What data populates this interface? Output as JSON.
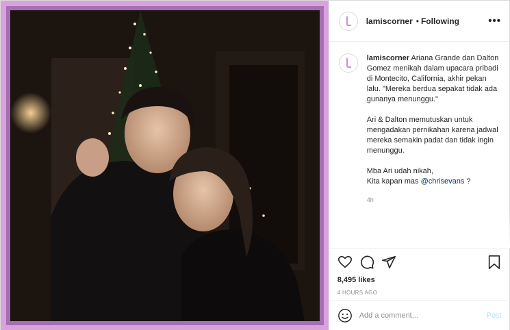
{
  "header": {
    "username": "lamiscorner",
    "separator": "•",
    "follow_status": "Following",
    "more_label": "•••"
  },
  "caption": {
    "username": "lamiscorner",
    "paragraph_1": "Ariana Grande dan Dalton Gomez menikah dalam upacara pribadi di Montecito, California, akhir pekan lalu. \"Mereka berdua sepakat tidak ada gunanya menunggu.\"",
    "paragraph_2": "Ari & Dalton memutuskan untuk mengadakan pernikahan karena jadwal mereka semakin padat dan tidak ingin menunggu.",
    "paragraph_3_line_1": "Mba Ari udah nikah,",
    "paragraph_3_line_2_prefix": "Kita kapan mas ",
    "mention": "@chrisevans",
    "paragraph_3_line_2_suffix": " ?",
    "time_ago": "4h"
  },
  "stats": {
    "likes": "8,495 likes",
    "posted": "4 HOURS AGO"
  },
  "add_comment": {
    "placeholder": "Add a comment...",
    "post_label": "Post"
  },
  "colors": {
    "frame_outer": "#d8a2dd",
    "frame_inner": "#a66fb3",
    "mention": "#00376b",
    "post_button_disabled": "#b2dffc",
    "avatar_glyph": "#c98fcf"
  },
  "icons": {
    "like": "heart-icon",
    "comment": "comment-bubble-icon",
    "share": "paper-plane-icon",
    "save": "bookmark-icon",
    "emoji": "smiley-icon"
  }
}
